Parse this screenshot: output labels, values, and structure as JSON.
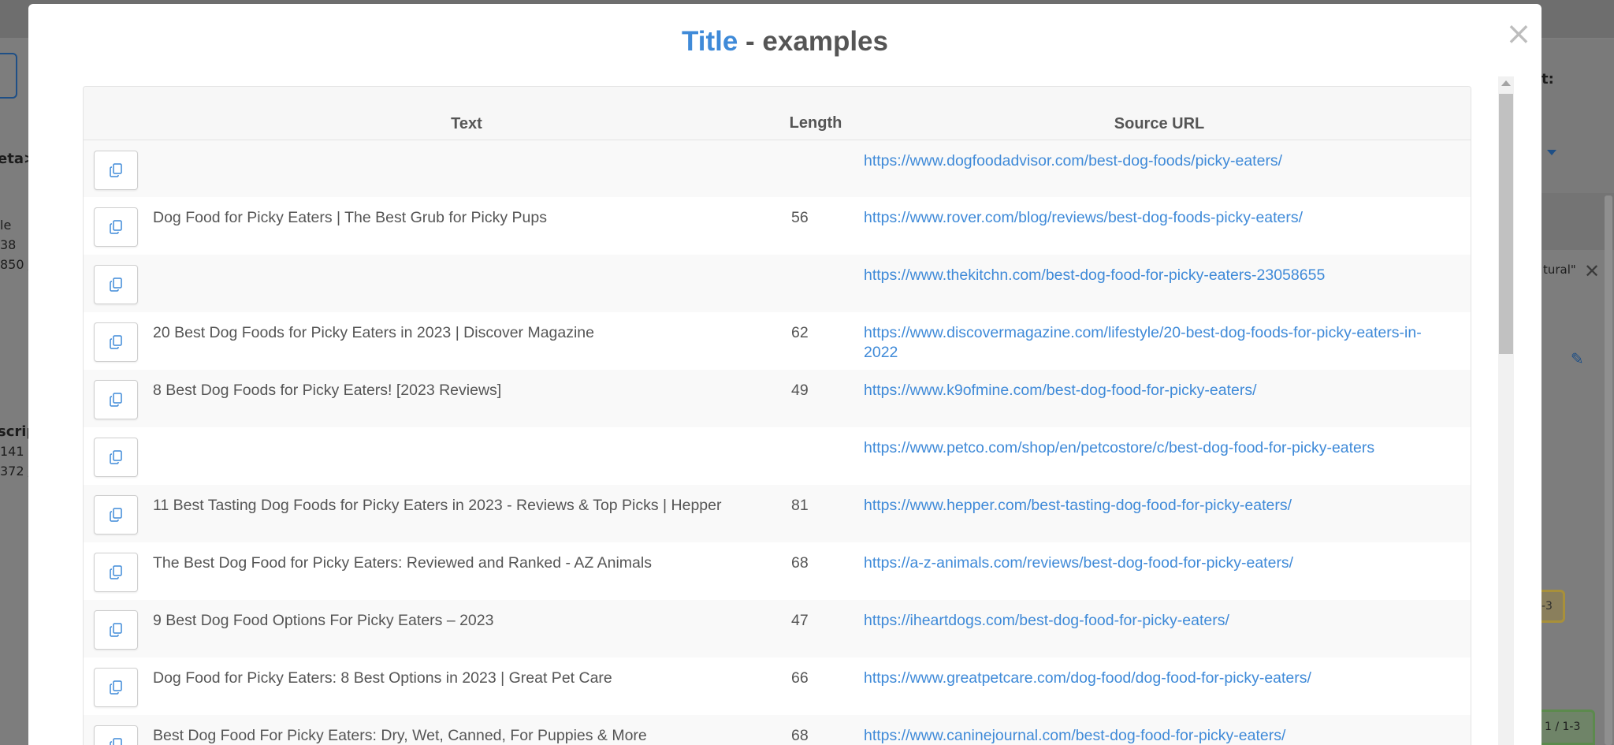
{
  "background": {
    "fragments": [
      "eta>",
      "le",
      "38",
      "850 /",
      "scrip",
      "141",
      "372 /",
      "t:",
      "tural\"",
      "-3",
      "1 / 1-3"
    ]
  },
  "modal": {
    "title_highlight": "Title",
    "title_rest": " - examples",
    "close_label": "×",
    "columns": {
      "copy": "",
      "text": "Text",
      "length": "Length",
      "source": "Source URL"
    },
    "rows": [
      {
        "text": "",
        "length": "",
        "url": "https://www.dogfoodadvisor.com/best-dog-foods/picky-eaters/"
      },
      {
        "text": "Dog Food for Picky Eaters | The Best Grub for Picky Pups",
        "length": "56",
        "url": "https://www.rover.com/blog/reviews/best-dog-foods-picky-eaters/"
      },
      {
        "text": "",
        "length": "",
        "url": "https://www.thekitchn.com/best-dog-food-for-picky-eaters-23058655"
      },
      {
        "text": "20 Best Dog Foods for Picky Eaters in 2023 | Discover Magazine",
        "length": "62",
        "url": "https://www.discovermagazine.com/lifestyle/20-best-dog-foods-for-picky-eaters-in-2022"
      },
      {
        "text": "8 Best Dog Foods for Picky Eaters! [2023 Reviews]",
        "length": "49",
        "url": "https://www.k9ofmine.com/best-dog-food-for-picky-eaters/"
      },
      {
        "text": "",
        "length": "",
        "url": "https://www.petco.com/shop/en/petcostore/c/best-dog-food-for-picky-eaters"
      },
      {
        "text": "11 Best Tasting Dog Foods for Picky Eaters in 2023 - Reviews & Top Picks | Hepper",
        "length": "81",
        "url": "https://www.hepper.com/best-tasting-dog-food-for-picky-eaters/"
      },
      {
        "text": "The Best Dog Food for Picky Eaters: Reviewed and Ranked - AZ Animals",
        "length": "68",
        "url": "https://a-z-animals.com/reviews/best-dog-food-for-picky-eaters/"
      },
      {
        "text": "9 Best Dog Food Options For Picky Eaters – 2023",
        "length": "47",
        "url": "https://iheartdogs.com/best-dog-food-for-picky-eaters/"
      },
      {
        "text": "Dog Food for Picky Eaters: 8 Best Options in 2023 | Great Pet Care",
        "length": "66",
        "url": "https://www.greatpetcare.com/dog-food/dog-food-for-picky-eaters/"
      },
      {
        "text": "Best Dog Food For Picky Eaters: Dry, Wet, Canned, For Puppies & More",
        "length": "68",
        "url": "https://www.caninejournal.com/best-dog-food-for-picky-eaters/"
      }
    ]
  },
  "icons": {
    "copy": "copy-icon",
    "close": "close-icon"
  },
  "colors": {
    "accent": "#3f8ad8",
    "text": "#555555",
    "overlay": "#7d7d7d"
  }
}
